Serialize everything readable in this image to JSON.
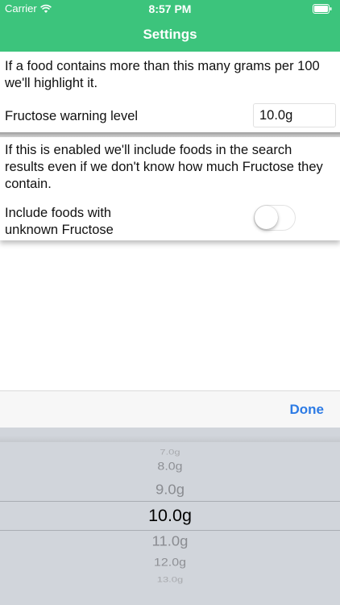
{
  "status_bar": {
    "carrier": "Carrier",
    "time": "8:57 PM"
  },
  "nav": {
    "title": "Settings"
  },
  "warning_section": {
    "description": "If a food contains more than this many grams per 100 we'll highlight it.",
    "label": "Fructose warning level",
    "value": "10.0g"
  },
  "unknown_section": {
    "description": "If this is enabled we'll include foods in the search results even if we don't know how much Fructose they contain.",
    "label": "Include foods with unknown Fructose",
    "enabled": false
  },
  "toolbar": {
    "done_label": "Done"
  },
  "picker": {
    "items": [
      "7.0g",
      "8.0g",
      "9.0g",
      "10.0g",
      "11.0g",
      "12.0g",
      "13.0g"
    ],
    "selected": "10.0g"
  },
  "colors": {
    "header": "#3cc47c",
    "accent": "#2d7be5",
    "picker_bg": "#d1d5db"
  }
}
